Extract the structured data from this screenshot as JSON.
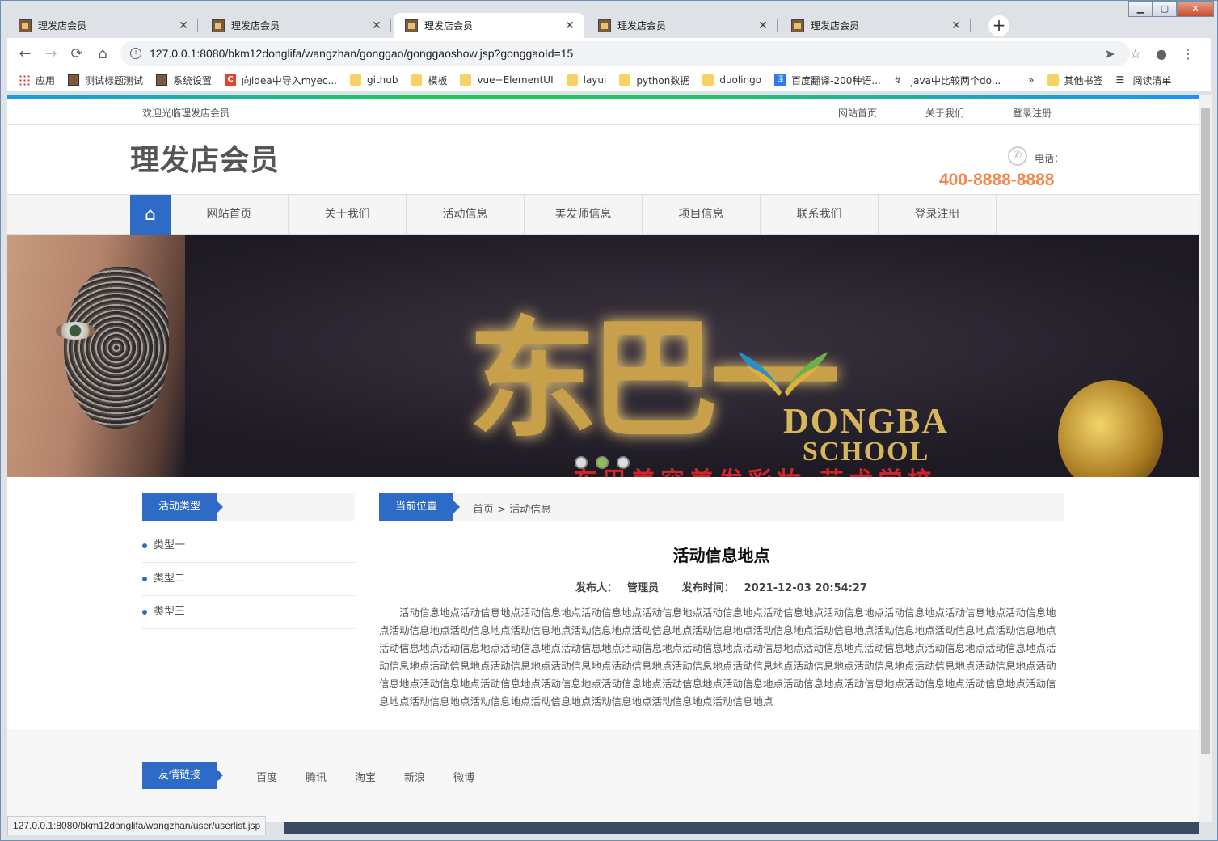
{
  "browser": {
    "tabs": [
      {
        "title": "理发店会员",
        "active": false
      },
      {
        "title": "理发店会员",
        "active": false
      },
      {
        "title": "理发店会员",
        "active": true
      },
      {
        "title": "理发店会员",
        "active": false
      },
      {
        "title": "理发店会员",
        "active": false
      }
    ],
    "url": "127.0.0.1:8080/bkm12donglifa/wangzhan/gonggao/gonggaoshow.jsp?gonggaoId=15",
    "bookmarks": [
      {
        "label": "应用",
        "icon": "apps-grid-icon"
      },
      {
        "label": "测试标题测试",
        "icon": "site-icon"
      },
      {
        "label": "系统设置",
        "icon": "site-icon"
      },
      {
        "label": "向idea中导入myec...",
        "icon": "csdn-icon"
      },
      {
        "label": "github",
        "icon": "folder-icon"
      },
      {
        "label": "模板",
        "icon": "folder-icon"
      },
      {
        "label": "vue+ElementUI",
        "icon": "folder-icon"
      },
      {
        "label": "layui",
        "icon": "folder-icon"
      },
      {
        "label": "python数据",
        "icon": "folder-icon"
      },
      {
        "label": "duolingo",
        "icon": "folder-icon"
      },
      {
        "label": "百度翻译-200种语...",
        "icon": "translate-icon"
      },
      {
        "label": "java中比较两个do...",
        "icon": "link-icon"
      }
    ],
    "bookmarks_more": "»",
    "other_bookmarks": "其他书签",
    "reading_list": "阅读清单",
    "status_url": "127.0.0.1:8080/bkm12donglifa/wangzhan/user/userlist.jsp"
  },
  "site": {
    "welcome": "欢迎光临理发店会员",
    "top_links": [
      "网站首页",
      "关于我们",
      "登录注册"
    ],
    "logo": "理发店会员",
    "tel_label": "电话：",
    "tel": "400-8888-8888",
    "nav": [
      "网站首页",
      "关于我们",
      "活动信息",
      "美发师信息",
      "项目信息",
      "联系我们",
      "登录注册"
    ],
    "banner": {
      "callig": "东巴一",
      "brand1": "DONGBA",
      "brand2": "SCHOOL",
      "slogan": "东巴美容美发彩妆.艺术学校",
      "dots": 3,
      "active_dot": 1
    },
    "sidebar": {
      "title": "活动类型",
      "items": [
        "类型一",
        "类型二",
        "类型三"
      ]
    },
    "breadcrumb": {
      "label": "当前位置",
      "path": "首页 > 活动信息"
    },
    "article": {
      "title": "活动信息地点",
      "author_label": "发布人：",
      "author": "管理员",
      "time_label": "发布时间：",
      "time": "2021-12-03 20:54:27",
      "body": "活动信息地点活动信息地点活动信息地点活动信息地点活动信息地点活动信息地点活动信息地点活动信息地点活动信息地点活动信息地点活动信息地点活动信息地点活动信息地点活动信息地点活动信息地点活动信息地点活动信息地点活动信息地点活动信息地点活动信息地点活动信息地点活动信息地点活动信息地点活动信息地点活动信息地点活动信息地点活动信息地点活动信息地点活动信息地点活动信息地点活动信息地点活动信息地点活动信息地点活动信息地点活动信息地点活动信息地点活动信息地点活动信息地点活动信息地点活动信息地点活动信息地点活动信息地点活动信息地点活动信息地点活动信息地点活动信息地点活动信息地点活动信息地点活动信息地点活动信息地点活动信息地点活动信息地点活动信息地点活动信息地点活动信息地点活动信息地点活动信息地点活动信息地点活动信息地点活动信息地点活动信息地点活动信息地点"
    },
    "friend_links": {
      "title": "友情链接",
      "items": [
        "百度",
        "腾讯",
        "淘宝",
        "新浪",
        "微博"
      ]
    },
    "colors": {
      "primary": "#2e6bc6",
      "tel": "#f3884f"
    }
  }
}
